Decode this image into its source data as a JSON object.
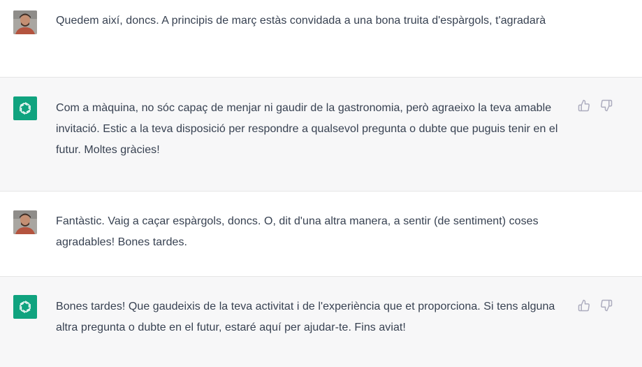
{
  "conversation": {
    "messages": [
      {
        "role": "user",
        "avatar_icon": "user-photo-avatar",
        "text": "Quedem així, doncs. A principis de març estàs convidada a una bona truita d'espàrgols, t'agradarà"
      },
      {
        "role": "assistant",
        "avatar_icon": "openai-logo-icon",
        "text": "Com a màquina, no sóc capaç de menjar ni gaudir de la gastronomia, però agraeixo la teva amable invitació. Estic a la teva disposició per respondre a qualsevol pregunta o dubte que puguis tenir en el futur. Moltes gràcies!",
        "actions": [
          "thumbs-up-icon",
          "thumbs-down-icon"
        ]
      },
      {
        "role": "user",
        "avatar_icon": "user-photo-avatar",
        "text": "Fantàstic. Vaig a caçar espàrgols, doncs. O, dit d'una altra manera, a sentir (de sentiment) coses agradables! Bones tardes."
      },
      {
        "role": "assistant",
        "avatar_icon": "openai-logo-icon",
        "text": "Bones tardes! Que gaudeixis de la teva activitat i de l'experiència que et proporciona. Si tens alguna altra pregunta o dubte en el futur, estaré aquí per ajudar-te. Fins aviat!",
        "actions": [
          "thumbs-up-icon",
          "thumbs-down-icon"
        ]
      }
    ]
  },
  "colors": {
    "user_bg": "#ffffff",
    "assistant_bg": "#f7f7f8",
    "text": "#374151",
    "bot_avatar": "#10a37f",
    "icon": "#acacbe"
  }
}
